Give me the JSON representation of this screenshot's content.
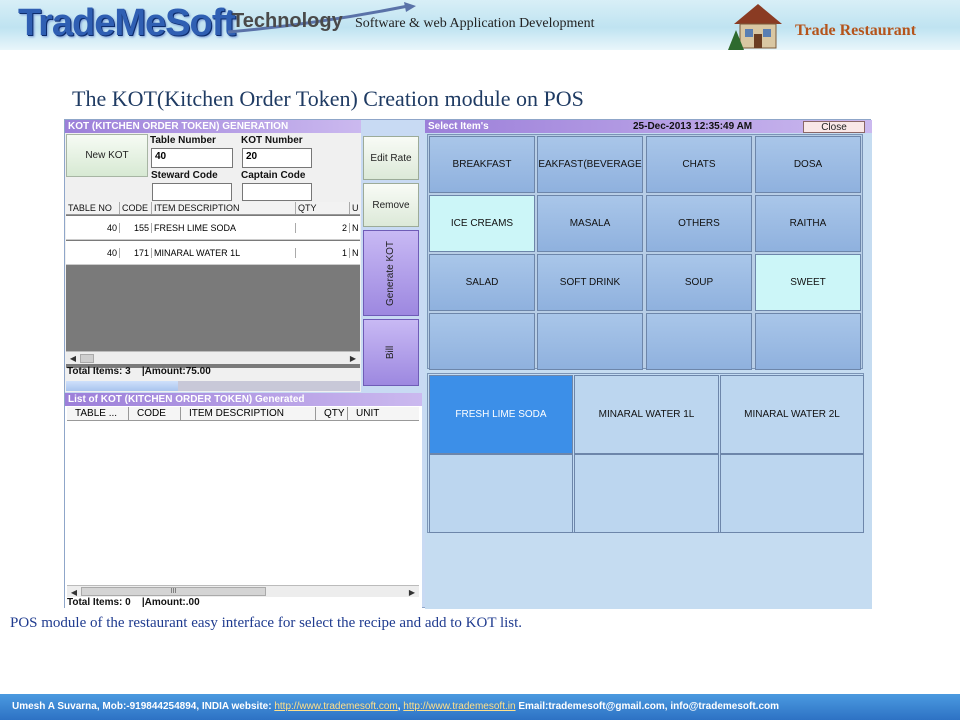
{
  "header": {
    "brand": "TradeMeSoft",
    "brand_suffix": "Technology",
    "tagline": "Software & web Application Development",
    "right_brand": "Trade Restaurant"
  },
  "page_title": "The KOT(Kitchen Order Token) Creation module on POS",
  "kot": {
    "title": "KOT  (KITCHEN ORDER TOKEN) GENERATION",
    "new_kot_label": "New KOT",
    "table_number_label": "Table Number",
    "table_number_value": "40",
    "kot_number_label": "KOT Number",
    "kot_number_value": "20",
    "steward_label": "Steward Code",
    "steward_value": "",
    "captain_label": "Captain Code",
    "captain_value": "",
    "columns": [
      "TABLE NO",
      "CODE",
      "ITEM DESCRIPTION",
      "QTY",
      "U"
    ],
    "rows": [
      {
        "table": "40",
        "code": "155",
        "desc": "FRESH LIME SODA",
        "qty": "2",
        "unit": "N"
      },
      {
        "table": "40",
        "code": "171",
        "desc": "MINARAL WATER 1L",
        "qty": "1",
        "unit": "N"
      }
    ],
    "total_items": "Total Items: 3",
    "amount": "|Amount:75.00",
    "progress_fraction": 0.38
  },
  "actions": {
    "edit_rate": "Edit Rate",
    "remove": "Remove",
    "generate_kot": "Generate KOT",
    "bill": "Bill"
  },
  "kot_list": {
    "title": "List of KOT  (KITCHEN ORDER TOKEN) Generated",
    "columns": [
      "TABLE ...",
      "CODE",
      "ITEM DESCRIPTION",
      "QTY",
      "UNIT"
    ],
    "scroll_mark": "III",
    "total_items": "Total Items: 0",
    "amount": "|Amount:.00"
  },
  "select": {
    "title": "Select Item's",
    "datetime": "25-Dec-2013 12:35:49 AM",
    "close_label": "Close",
    "categories": [
      "BREAKFAST",
      "EAKFAST(BEVERAGE",
      "CHATS",
      "DOSA",
      "ICE CREAMS",
      "MASALA",
      "OTHERS",
      "RAITHA",
      "SALAD",
      "SOFT DRINK",
      "SOUP",
      "SWEET",
      "",
      "",
      "",
      ""
    ],
    "items": [
      "FRESH LIME SODA",
      "MINARAL WATER 1L",
      "MINARAL WATER 2L",
      "",
      "",
      ""
    ],
    "active_item": "FRESH LIME SODA"
  },
  "caption": "POS module of the restaurant  easy interface for select the recipe and add to KOT list.",
  "footer": {
    "contact": "Umesh A Suvarna, Mob:-919844254894, INDIA   website: ",
    "link1": "http://www.trademesoft.com",
    "separator": ",   ",
    "link2": "http://www.trademesoft.in",
    "email": "   Email:trademesoft@gmail.com,  info@trademesoft.com"
  },
  "colors": {
    "title_bar": "#9c7fd9",
    "category_tile": "#8fb1de",
    "category_highlight": "#ccf6f8",
    "item_active": "#3c8fe8",
    "footer": "#2d72c4"
  }
}
